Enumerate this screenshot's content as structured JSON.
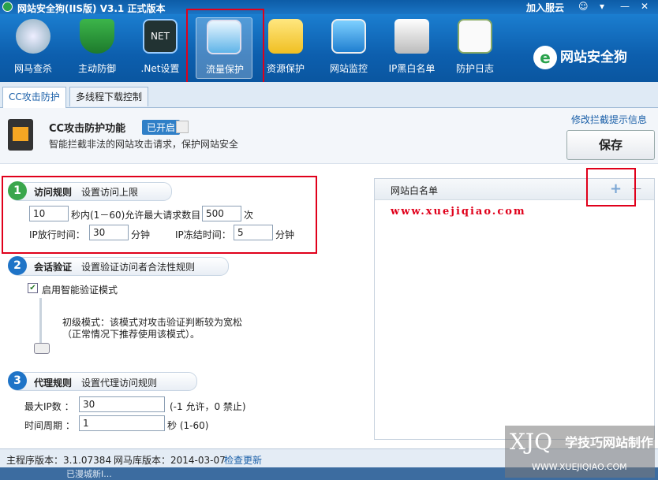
{
  "window": {
    "title": "网站安全狗(IIS版) V3.1 正式版本",
    "join_cloud": "加入服云",
    "controls": [
      "☺",
      "▾",
      "—",
      "✕"
    ]
  },
  "toolbar": {
    "items": [
      {
        "label": "网马查杀",
        "icon": "horse-icon"
      },
      {
        "label": "主动防御",
        "icon": "shield-icon"
      },
      {
        "label": ".Net设置",
        "icon": "dotnet-icon"
      },
      {
        "label": "流量保护",
        "icon": "traffic-chart-icon"
      },
      {
        "label": "资源保护",
        "icon": "folder-check-icon"
      },
      {
        "label": "网站监控",
        "icon": "monitor-icon"
      },
      {
        "label": "IP黑白名单",
        "icon": "router-icon"
      },
      {
        "label": "防护日志",
        "icon": "clipboard-icon"
      }
    ],
    "brand": "网站安全狗"
  },
  "tabs": [
    "CC攻击防护",
    "多线程下载控制"
  ],
  "feature": {
    "title": "CC攻击防护功能",
    "status": "已开启",
    "desc": "智能拦截非法的网站攻击请求，保护网站安全",
    "edit_link": "修改拦截提示信息",
    "save": "保存"
  },
  "rules": {
    "section1": {
      "num": "1",
      "title": "访问规则",
      "subtitle": "设置访问上限"
    },
    "seconds": "10",
    "seconds_text": "秒内(1－60)允许最大请求数目",
    "max_requests": "500",
    "times": "次",
    "ip_release_label": "IP放行时间：",
    "ip_release": "30",
    "minute1": "分钟",
    "ip_freeze_label": "IP冻结时间：",
    "ip_freeze": "5",
    "minute2": "分钟",
    "section2": {
      "num": "2",
      "title": "会话验证",
      "subtitle": "设置验证访问者合法性规则"
    },
    "smart_mode": "启用智能验证模式",
    "mode_line1": "初级模式：该模式对攻击验证判断较为宽松",
    "mode_line2": "（正常情况下推荐使用该模式）。",
    "section3": {
      "num": "3",
      "title": "代理规则",
      "subtitle": "设置代理访问规则"
    },
    "max_ip_label": "最大IP数 ：",
    "max_ip": "30",
    "max_ip_hint": "(-1 允许，0 禁止)",
    "period_label": "时间周期 ：",
    "period": "1",
    "period_hint": "秒 (1-60)"
  },
  "whitelist": {
    "title": "网站白名单",
    "add": "+",
    "remove": "—",
    "watermark_url": "www.xuejiqiao.com"
  },
  "statusbar": {
    "main_version": "主程序版本：3.1.07384",
    "lib_version": "网马库版本：2014-03-07",
    "check_update": "检查更新",
    "bottom_text": "已漫城新I..."
  },
  "watermark": {
    "logo": "XJQ",
    "text": "学技巧网站制作",
    "url": "WWW.XUEJIQIAO.COM"
  },
  "colors": {
    "accent": "#1a74c4",
    "highlight": "#e0001b",
    "green": "#2aa24b"
  }
}
